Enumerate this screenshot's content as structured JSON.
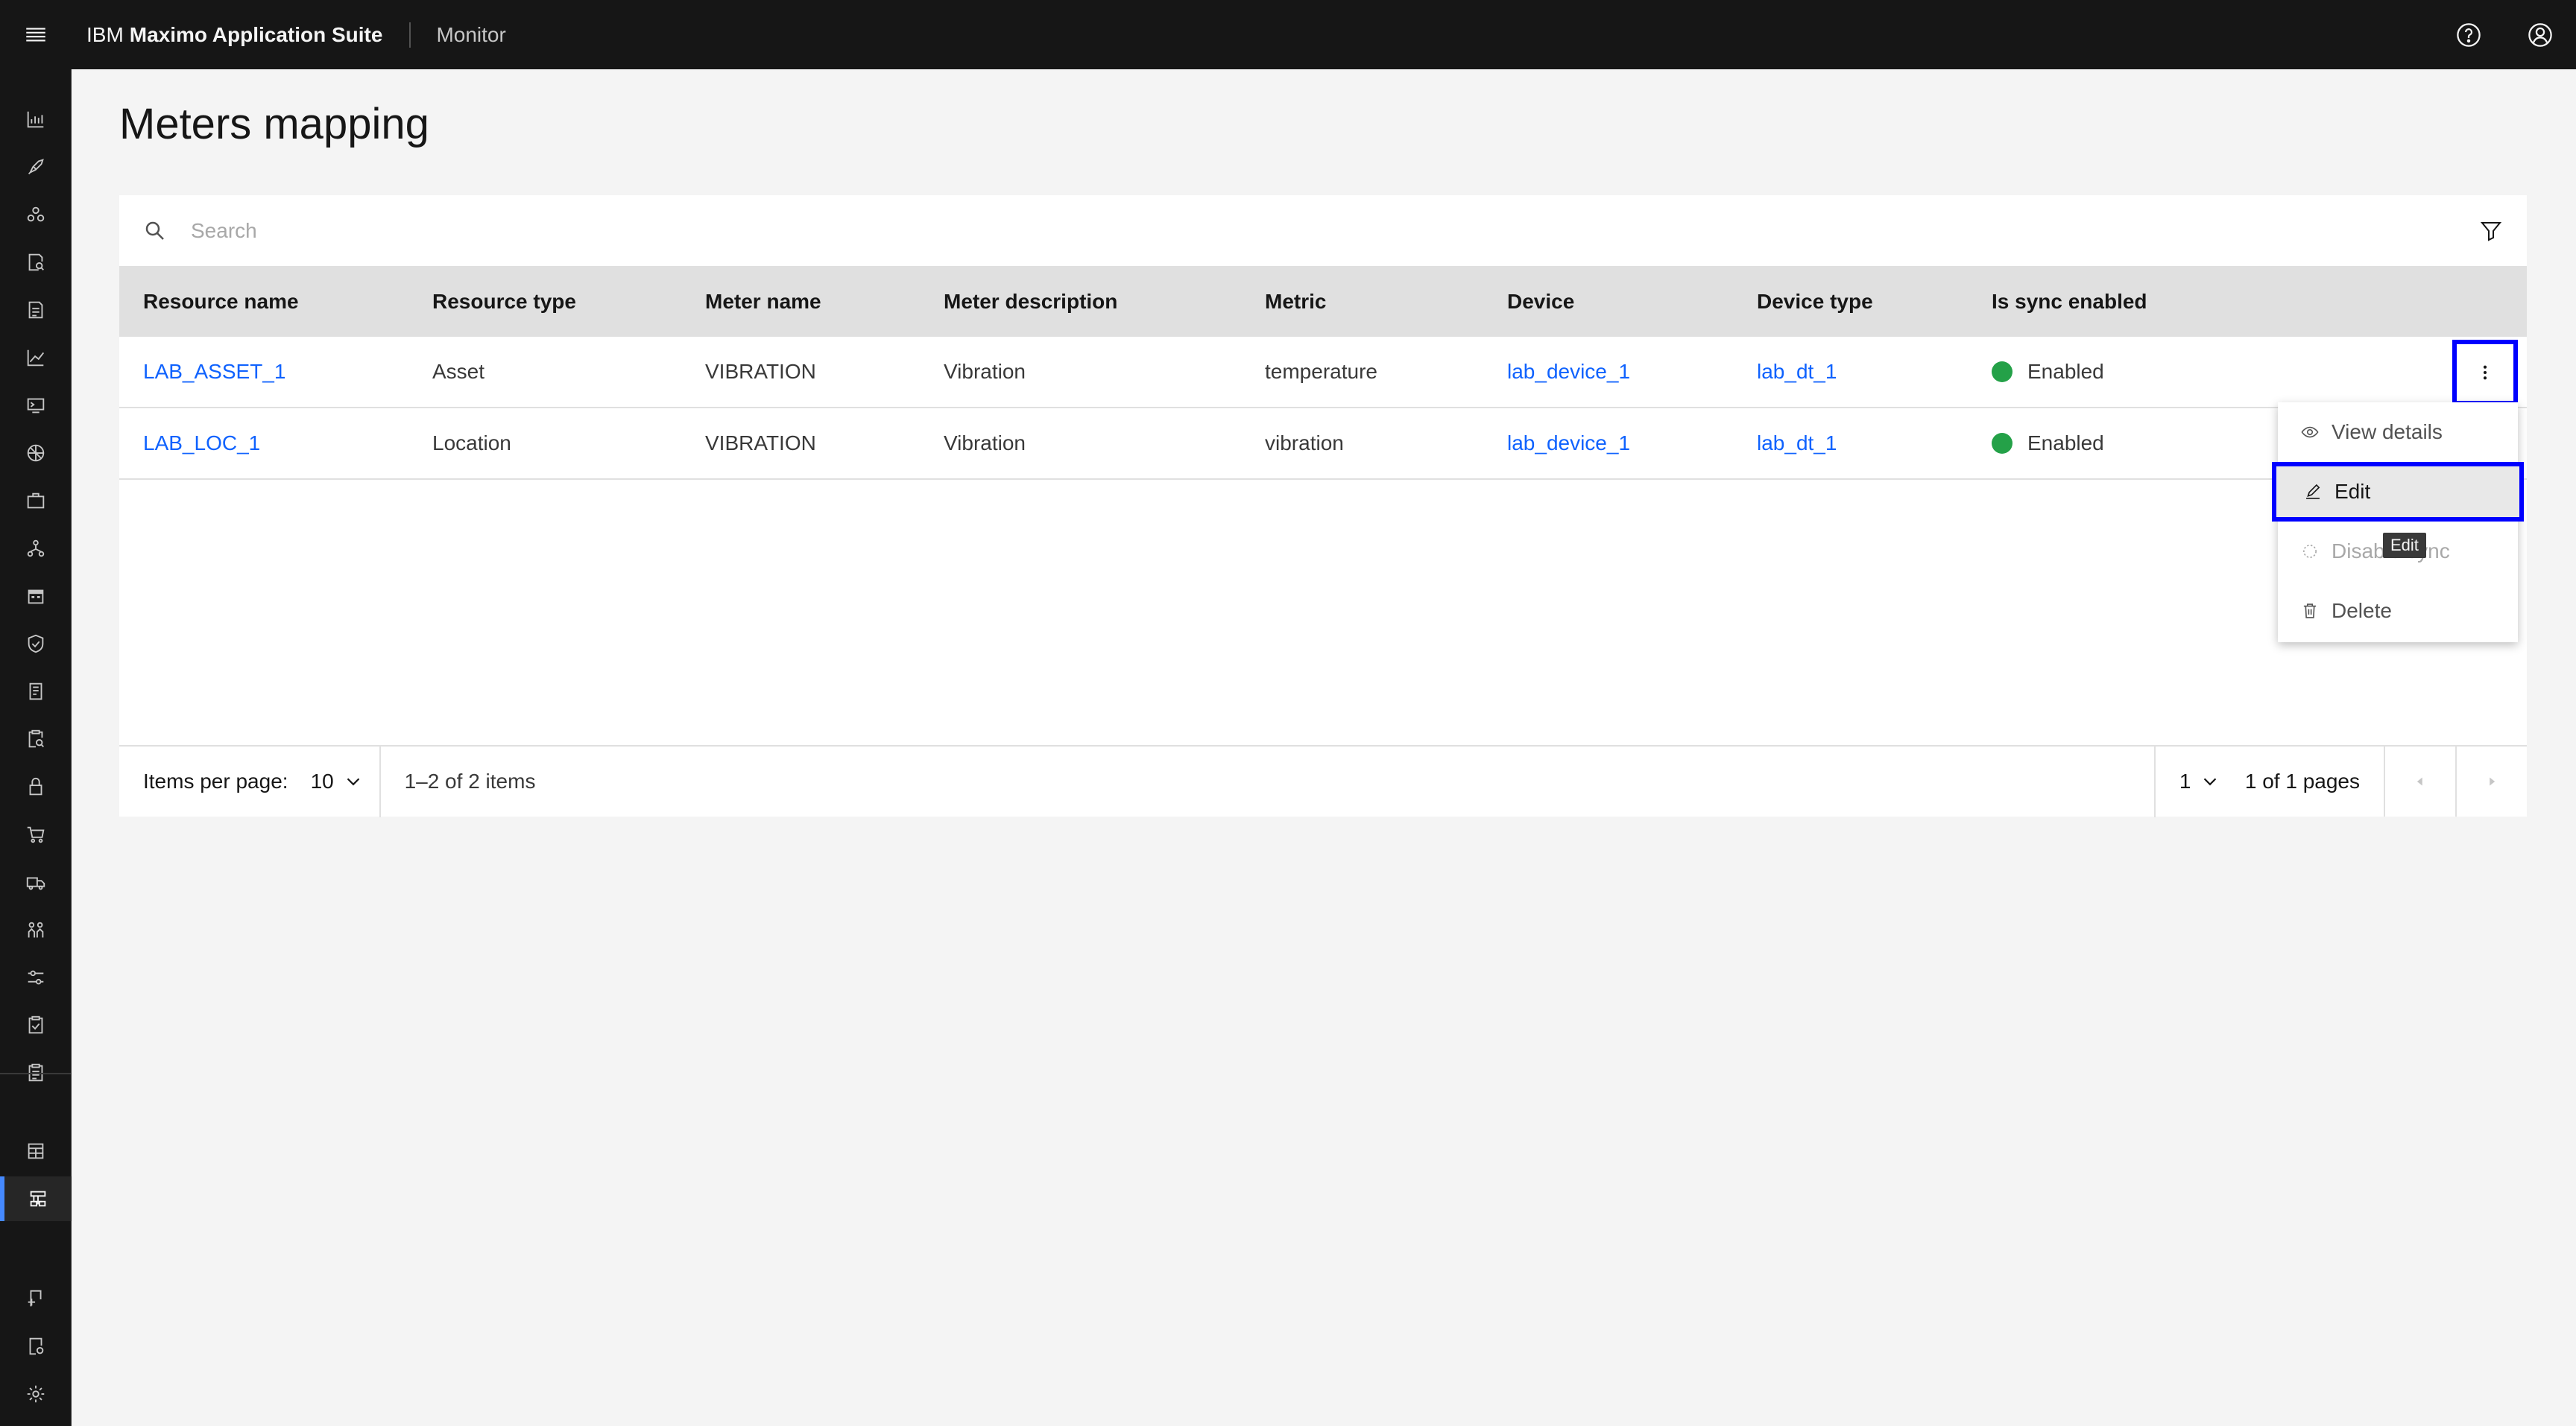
{
  "header": {
    "brand_ibm": "IBM",
    "brand_product": "Maximo Application Suite",
    "app_name": "Monitor"
  },
  "page": {
    "title": "Meters mapping"
  },
  "search": {
    "placeholder": "Search"
  },
  "table": {
    "columns": [
      "Resource name",
      "Resource type",
      "Meter name",
      "Meter description",
      "Metric",
      "Device",
      "Device type",
      "Is sync enabled"
    ],
    "rows": [
      {
        "resource_name": "LAB_ASSET_1",
        "resource_type": "Asset",
        "meter_name": "VIBRATION",
        "meter_description": "Vibration",
        "metric": "temperature",
        "device": "lab_device_1",
        "device_type": "lab_dt_1",
        "sync": "Enabled"
      },
      {
        "resource_name": "LAB_LOC_1",
        "resource_type": "Location",
        "meter_name": "VIBRATION",
        "meter_description": "Vibration",
        "metric": "vibration",
        "device": "lab_device_1",
        "device_type": "lab_dt_1",
        "sync": "Enabled"
      }
    ]
  },
  "pagination": {
    "items_per_page_label": "Items per page:",
    "items_per_page": "10",
    "range": "1–2 of 2 items",
    "page": "1",
    "page_of": "1 of 1 pages"
  },
  "menu": {
    "items": [
      {
        "label": "View details",
        "icon": "eye-icon"
      },
      {
        "label": "Edit",
        "icon": "edit-icon"
      },
      {
        "label": "Disable sync",
        "icon": "sync-disabled-icon"
      },
      {
        "label": "Delete",
        "icon": "trash-icon"
      }
    ],
    "tooltip": "Edit"
  },
  "colors": {
    "header_bg": "#161616",
    "link": "#0f62fe",
    "enabled": "#24a148",
    "highlight_border": "#0000ff"
  }
}
